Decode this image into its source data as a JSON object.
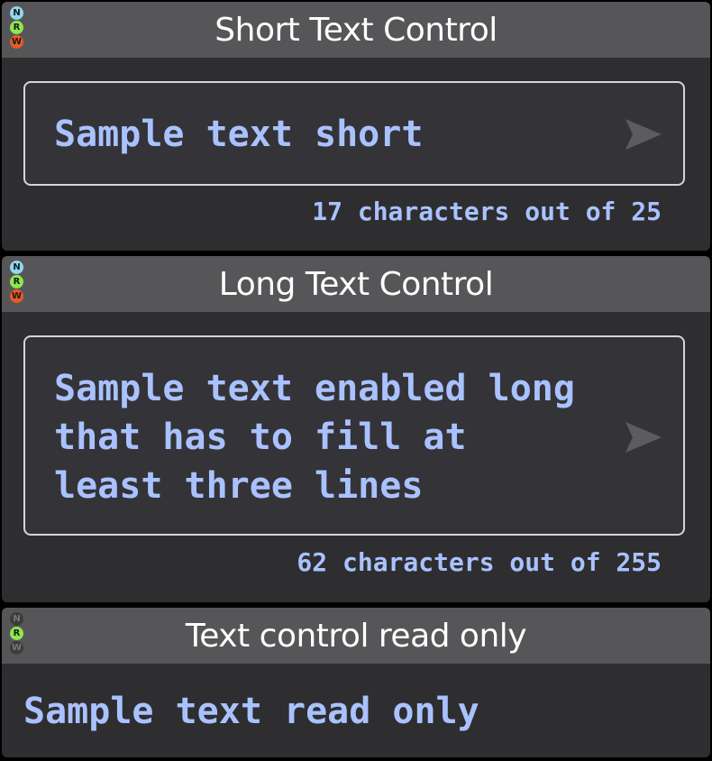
{
  "badge_letters": [
    "N",
    "R",
    "W"
  ],
  "short_control": {
    "title": "Short Text Control",
    "value": "Sample text short",
    "counter": "17 characters out of 25",
    "badges_active": [
      true,
      true,
      true
    ]
  },
  "long_control": {
    "title": "Long Text Control",
    "value": "Sample text enabled long\nthat has to fill at\nleast three lines",
    "counter": "62 characters out of 255",
    "badges_active": [
      true,
      true,
      true
    ]
  },
  "readonly_control": {
    "title": "Text control read only",
    "value": "Sample text read only",
    "badges_active": [
      false,
      true,
      false
    ]
  },
  "icons": {
    "send": "send-icon",
    "badge_n": "notify-badge-icon",
    "badge_r": "read-badge-icon",
    "badge_w": "write-badge-icon"
  },
  "colors": {
    "text_accent": "#a9c2ff",
    "panel_bg": "#2e2e30",
    "header_bg": "#565658",
    "badge_n": "#8fd8f2",
    "badge_r": "#8ee84f",
    "badge_w": "#e85a22",
    "badge_off": "#3c3c3c"
  }
}
